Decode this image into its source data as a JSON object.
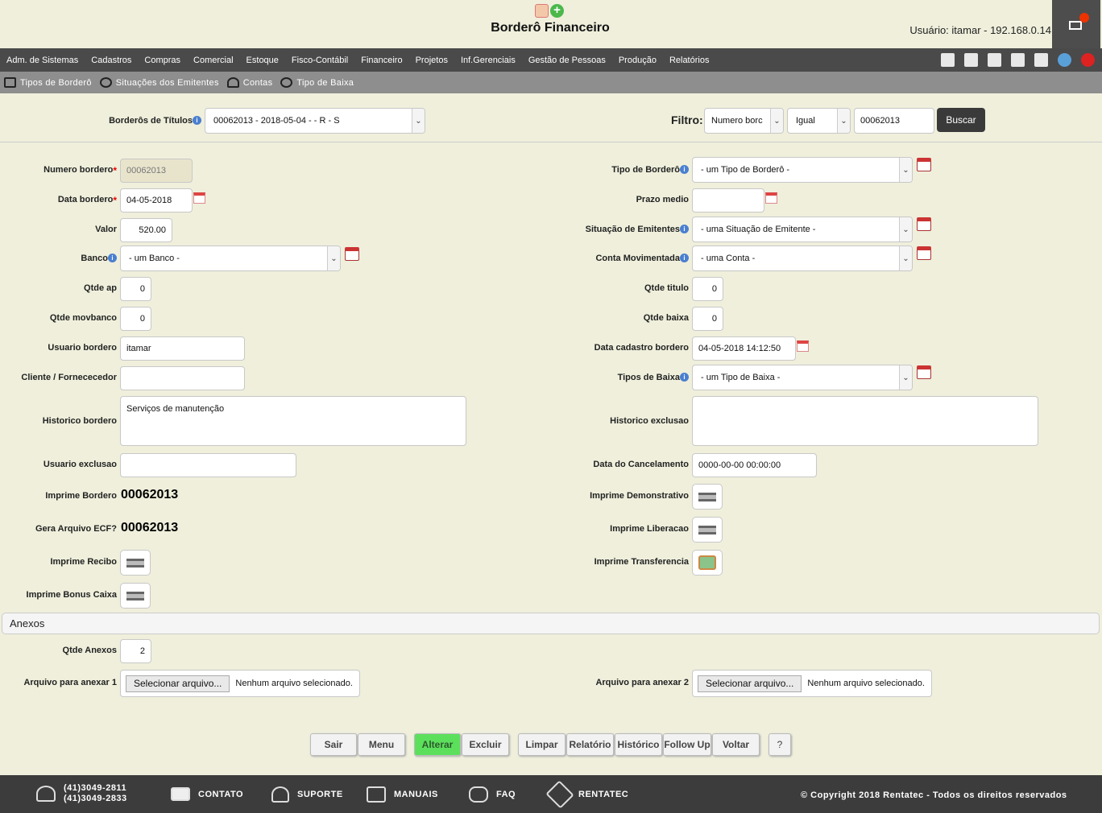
{
  "header": {
    "title": "Borderô Financeiro",
    "user_info": "Usuário: itamar - 192.168.0.14"
  },
  "menu": [
    "Adm. de Sistemas",
    "Cadastros",
    "Compras",
    "Comercial",
    "Estoque",
    "Fisco-Contábil",
    "Financeiro",
    "Projetos",
    "Inf.Gerenciais",
    "Gestão de Pessoas",
    "Produção",
    "Relatórios"
  ],
  "submenu": [
    "Tipos de Borderô",
    "Situações dos Emitentes",
    "Contas",
    "Tipo de Baixa"
  ],
  "filter_row": {
    "borderos_label": "Borderôs de Títulos",
    "borderos_value": "00062013 - 2018-05-04 - - R - S",
    "filtro_label": "Filtro:",
    "field_value": "Numero borc",
    "operator_value": "Igual",
    "search_value": "00062013",
    "search_button": "Buscar"
  },
  "left": {
    "numero_label": "Numero bordero",
    "numero_value": "00062013",
    "data_label": "Data bordero",
    "data_value": "04-05-2018",
    "valor_label": "Valor",
    "valor_value": "520.00",
    "banco_label": "Banco",
    "banco_value": "- um Banco -",
    "qtde_ap_label": "Qtde ap",
    "qtde_ap_value": "0",
    "qtde_mov_label": "Qtde movbanco",
    "qtde_mov_value": "0",
    "usuario_label": "Usuario bordero",
    "usuario_value": "itamar",
    "cliente_label": "Cliente / Fornececedor",
    "cliente_value": "",
    "historico_label": "Historico bordero",
    "historico_value": "Serviços de manutenção",
    "usuario_exc_label": "Usuario exclusao",
    "usuario_exc_value": "",
    "imprime_label": "Imprime Bordero",
    "imprime_value": "00062013",
    "gera_label": "Gera Arquivo ECF?",
    "gera_value": "00062013",
    "recibo_label": "Imprime Recibo",
    "bonus_label": "Imprime Bonus Caixa"
  },
  "right": {
    "tipo_label": "Tipo de Borderô",
    "tipo_value": "- um Tipo de Borderô -",
    "prazo_label": "Prazo medio",
    "prazo_value": "",
    "situacao_label": "Situação de Emitentes",
    "situacao_value": "- uma Situação de Emitente -",
    "conta_label": "Conta Movimentada",
    "conta_value": "- uma Conta -",
    "qtde_titulo_label": "Qtde titulo",
    "qtde_titulo_value": "0",
    "qtde_baixa_label": "Qtde baixa",
    "qtde_baixa_value": "0",
    "data_cad_label": "Data cadastro bordero",
    "data_cad_value": "04-05-2018 14:12:50",
    "tipos_baixa_label": "Tipos de Baixa",
    "tipos_baixa_value": "- um Tipo de Baixa -",
    "hist_exc_label": "Historico exclusao",
    "hist_exc_value": "",
    "data_canc_label": "Data do Cancelamento",
    "data_canc_value": "0000-00-00 00:00:00",
    "demonstrativo_label": "Imprime Demonstrativo",
    "liberacao_label": "Imprime Liberacao",
    "transferencia_label": "Imprime Transferencia"
  },
  "anexos": {
    "title": "Anexos",
    "qtde_label": "Qtde Anexos",
    "qtde_value": "2",
    "arquivo1_label": "Arquivo para anexar 1",
    "arquivo2_label": "Arquivo para anexar 2",
    "file_button": "Selecionar arquivo...",
    "no_file": "Nenhum arquivo selecionado."
  },
  "buttons": [
    "Sair",
    "Menu",
    "Alterar",
    "Excluir",
    "Limpar",
    "Relatório",
    "Histórico",
    "Follow Up",
    "Voltar",
    "?"
  ],
  "footer": {
    "phone1": "(41)3049-2811",
    "phone2": "(41)3049-2833",
    "contato": "CONTATO",
    "suporte": "SUPORTE",
    "manuais": "MANUAIS",
    "faq": "FAQ",
    "rentatec": "RENTATEC",
    "copyright": "© Copyright 2018 Rentatec - Todos os direitos reservados"
  },
  "colors": {
    "background": "#efefdc",
    "menubar": "#4a4a4a",
    "submenu": "#8e8e8e",
    "alterar_green": "#5ce05c",
    "footer": "#3c3c3c"
  }
}
